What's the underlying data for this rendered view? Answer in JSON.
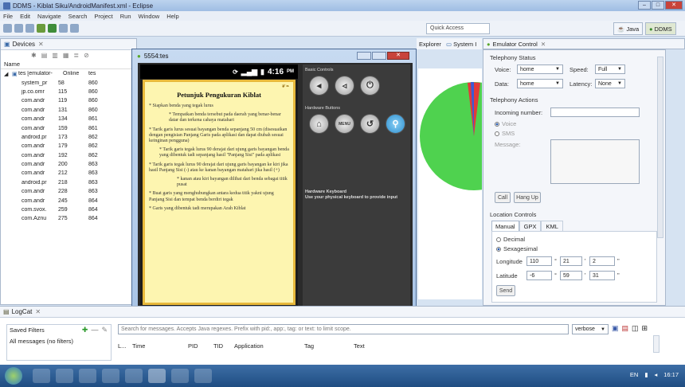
{
  "window": {
    "title": "DDMS - Kiblat Siku/AndroidManifest.xml - Eclipse"
  },
  "menu": [
    "File",
    "Edit",
    "Navigate",
    "Search",
    "Project",
    "Run",
    "Window",
    "Help"
  ],
  "toolbar": {
    "quick_access": "Quick Access",
    "perspective_java": "Java",
    "perspective_ddms": "DDMS"
  },
  "devices": {
    "tab_label": "Devices",
    "column_name": "Name",
    "root": {
      "name": "tes [emulator-",
      "status": "Online",
      "extra": "tes"
    },
    "rows": [
      {
        "name": "system_pr",
        "pid": "58",
        "port": "860"
      },
      {
        "name": "jp.co.omr",
        "pid": "115",
        "port": "860"
      },
      {
        "name": "com.andr",
        "pid": "119",
        "port": "860"
      },
      {
        "name": "com.andr",
        "pid": "131",
        "port": "860"
      },
      {
        "name": "com.andr",
        "pid": "134",
        "port": "861"
      },
      {
        "name": "com.andr",
        "pid": "159",
        "port": "861"
      },
      {
        "name": "android.pr",
        "pid": "173",
        "port": "862"
      },
      {
        "name": "com.andr",
        "pid": "179",
        "port": "862"
      },
      {
        "name": "com.andr",
        "pid": "192",
        "port": "862"
      },
      {
        "name": "com.andr",
        "pid": "200",
        "port": "863"
      },
      {
        "name": "com.andr",
        "pid": "212",
        "port": "863"
      },
      {
        "name": "android.pr",
        "pid": "218",
        "port": "863"
      },
      {
        "name": "com.andr",
        "pid": "228",
        "port": "863"
      },
      {
        "name": "com.andr",
        "pid": "245",
        "port": "864"
      },
      {
        "name": "com.svox.",
        "pid": "259",
        "port": "864"
      },
      {
        "name": "com.Aznu",
        "pid": "275",
        "port": "864"
      }
    ]
  },
  "side_tabs": {
    "explorer": "Explorer",
    "system": "System I"
  },
  "emulator": {
    "window_title": "5554:tes",
    "time": "4:16",
    "ampm": "PM",
    "paper_title": "Petunjuk Pengukuran Kiblat",
    "steps": [
      "* Siapkan benda yang tegak lurus",
      "* Tempatkan benda tersebut pada daerah yang benar-benar datar dan terkena cahaya matahari",
      "* Tarik garis lurus sesuai bayangan benda sepanjang 50 cm (disesuaikan dengan pengisian Panjang Garis pada aplikasi dan dapat diubah sesuai keinginan pengguna)",
      "* Tarik garis tegak lurus 90 derajat dari ujung garis bayangan benda yang dibentuk tadi sepanjang hasil \"Panjang Sisi\" pada aplikasi",
      "* Tarik garis tegak lurus 90 derajat dari ujung garis bayangan ke kiri jika hasil Panjang Sisi (-) atau ke kanan bayangan matahari jika hasil (+)",
      "* kanan atau kiri bayangan dilihat dari benda sebagai titik pusat",
      "* Buat garis yang menghubungkan antara kedua titik yakni ujung Panjang Sisi dan tempat benda berdiri tegak",
      "* Garis yang dibentuk tadi merupakan Arah Kiblat"
    ],
    "controls": {
      "basic": "Basic Controls",
      "hardware": "Hardware Buttons",
      "menu": "MENU",
      "keyboard_title": "Hardware Keyboard",
      "keyboard_note": "Use your physical keyboard to provide input"
    }
  },
  "emulator_control": {
    "tab_label": "Emulator Control",
    "telephony_status": "Telephony Status",
    "voice_label": "Voice:",
    "voice_value": "home",
    "speed_label": "Speed:",
    "speed_value": "Full",
    "data_label": "Data:",
    "data_value": "home",
    "latency_label": "Latency:",
    "latency_value": "None",
    "telephony_actions": "Telephony Actions",
    "incoming_label": "Incoming number:",
    "voice_radio": "Voice",
    "sms_radio": "SMS",
    "message_label": "Message:",
    "call_btn": "Call",
    "hangup_btn": "Hang Up",
    "location_controls": "Location Controls",
    "tabs": [
      "Manual",
      "GPX",
      "KML"
    ],
    "decimal": "Decimal",
    "sexagesimal": "Sexagesimal",
    "longitude_label": "Longitude",
    "lon_deg": "110",
    "lon_min": "21",
    "lon_sec": "2",
    "latitude_label": "Latitude",
    "lat_deg": "-6",
    "lat_min": "59",
    "lat_sec": "31",
    "send_btn": "Send"
  },
  "logcat": {
    "tab_label": "LogCat",
    "saved_filters": "Saved Filters",
    "all_messages": "All messages (no filters)",
    "search_placeholder": "Search for messages. Accepts Java regexes. Prefix with pid:, app:, tag: or text: to limit scope.",
    "level": "verbose",
    "columns": [
      "L...",
      "Time",
      "PID",
      "TID",
      "Application",
      "Tag",
      "Text"
    ]
  },
  "tray": {
    "lang": "EN",
    "clock": "16:17"
  }
}
